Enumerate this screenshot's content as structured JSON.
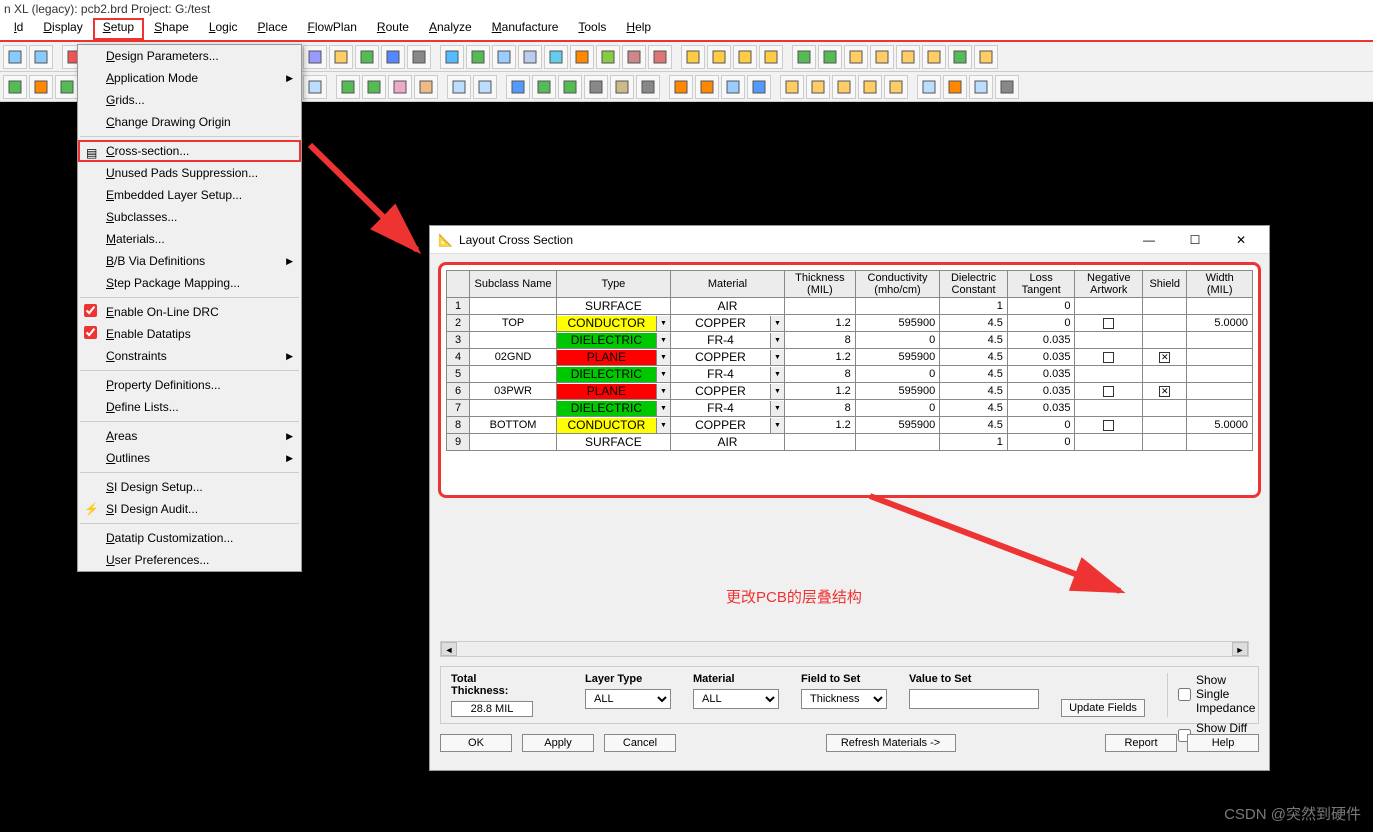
{
  "title": "n XL (legacy): pcb2.brd  Project: G:/test",
  "menubar": [
    "ld",
    "Display",
    "Setup",
    "Shape",
    "Logic",
    "Place",
    "FlowPlan",
    "Route",
    "Analyze",
    "Manufacture",
    "Tools",
    "Help"
  ],
  "menubar_open_index": 2,
  "setup_menu": {
    "items": [
      {
        "label": "Design Parameters...",
        "type": "item"
      },
      {
        "label": "Application Mode",
        "type": "sub"
      },
      {
        "label": "Grids...",
        "type": "item"
      },
      {
        "label": "Change Drawing Origin",
        "type": "item"
      },
      {
        "type": "sep"
      },
      {
        "label": "Cross-section...",
        "type": "item",
        "highlight": true,
        "icon": "stack"
      },
      {
        "label": "Unused Pads Suppression...",
        "type": "item"
      },
      {
        "label": "Embedded Layer Setup...",
        "type": "item"
      },
      {
        "label": "Subclasses...",
        "type": "item"
      },
      {
        "label": "Materials...",
        "type": "item"
      },
      {
        "label": "B/B Via Definitions",
        "type": "sub"
      },
      {
        "label": "Step Package Mapping...",
        "type": "item"
      },
      {
        "type": "sep"
      },
      {
        "label": "Enable On-Line DRC",
        "type": "check",
        "checked": true
      },
      {
        "label": "Enable Datatips",
        "type": "check",
        "checked": true
      },
      {
        "label": "Constraints",
        "type": "sub"
      },
      {
        "type": "sep"
      },
      {
        "label": "Property Definitions...",
        "type": "item"
      },
      {
        "label": "Define Lists...",
        "type": "item"
      },
      {
        "type": "sep"
      },
      {
        "label": "Areas",
        "type": "sub"
      },
      {
        "label": "Outlines",
        "type": "sub"
      },
      {
        "type": "sep"
      },
      {
        "label": "SI Design Setup...",
        "type": "item"
      },
      {
        "label": "SI Design Audit...",
        "type": "item",
        "icon": "bolt"
      },
      {
        "type": "sep"
      },
      {
        "label": "Datatip Customization...",
        "type": "item"
      },
      {
        "label": "User Preferences...",
        "type": "item"
      }
    ]
  },
  "dialog": {
    "title": "Layout Cross Section",
    "headers": [
      "",
      "Subclass Name",
      "Type",
      "Material",
      "Thickness (MIL)",
      "Conductivity (mho/cm)",
      "Dielectric Constant",
      "Loss Tangent",
      "Negative Artwork",
      "Shield",
      "Width (MIL)"
    ],
    "rows": [
      {
        "n": "1",
        "sub": "",
        "type": "SURFACE",
        "type_cls": "",
        "mat": "AIR",
        "thk": "",
        "cond": "",
        "dc": "1",
        "lt": "0",
        "neg": "",
        "sh": "",
        "w": ""
      },
      {
        "n": "2",
        "sub": "TOP",
        "type": "CONDUCTOR",
        "type_cls": "conductor",
        "mat": "COPPER",
        "thk": "1.2",
        "cond": "595900",
        "dc": "4.5",
        "lt": "0",
        "neg": "box",
        "sh": "",
        "w": "5.0000"
      },
      {
        "n": "3",
        "sub": "",
        "type": "DIELECTRIC",
        "type_cls": "dielectric",
        "mat": "FR-4",
        "thk": "8",
        "cond": "0",
        "dc": "4.5",
        "lt": "0.035",
        "neg": "",
        "sh": "",
        "w": ""
      },
      {
        "n": "4",
        "sub": "02GND",
        "type": "PLANE",
        "type_cls": "plane",
        "mat": "COPPER",
        "thk": "1.2",
        "cond": "595900",
        "dc": "4.5",
        "lt": "0.035",
        "neg": "box",
        "sh": "x",
        "w": ""
      },
      {
        "n": "5",
        "sub": "",
        "type": "DIELECTRIC",
        "type_cls": "dielectric",
        "mat": "FR-4",
        "thk": "8",
        "cond": "0",
        "dc": "4.5",
        "lt": "0.035",
        "neg": "",
        "sh": "",
        "w": ""
      },
      {
        "n": "6",
        "sub": "03PWR",
        "type": "PLANE",
        "type_cls": "plane",
        "mat": "COPPER",
        "thk": "1.2",
        "cond": "595900",
        "dc": "4.5",
        "lt": "0.035",
        "neg": "box",
        "sh": "x",
        "w": ""
      },
      {
        "n": "7",
        "sub": "",
        "type": "DIELECTRIC",
        "type_cls": "dielectric",
        "mat": "FR-4",
        "thk": "8",
        "cond": "0",
        "dc": "4.5",
        "lt": "0.035",
        "neg": "",
        "sh": "",
        "w": ""
      },
      {
        "n": "8",
        "sub": "BOTTOM",
        "type": "CONDUCTOR",
        "type_cls": "conductor",
        "mat": "COPPER",
        "thk": "1.2",
        "cond": "595900",
        "dc": "4.5",
        "lt": "0",
        "neg": "box",
        "sh": "",
        "w": "5.0000"
      },
      {
        "n": "9",
        "sub": "",
        "type": "SURFACE",
        "type_cls": "",
        "mat": "AIR",
        "thk": "",
        "cond": "",
        "dc": "1",
        "lt": "0",
        "neg": "",
        "sh": "",
        "w": ""
      }
    ],
    "total_thickness_label": "Total Thickness:",
    "total_thickness": "28.8 MIL",
    "layer_type_label": "Layer Type",
    "layer_type": "ALL",
    "material_label": "Material",
    "material": "ALL",
    "field_label": "Field to Set",
    "field": "Thickness",
    "value_label": "Value to Set",
    "value": "",
    "update_btn": "Update Fields",
    "show_single": "Show Single Impedance",
    "show_diff": "Show Diff Impedance",
    "buttons": {
      "ok": "OK",
      "apply": "Apply",
      "cancel": "Cancel",
      "refresh": "Refresh Materials ->",
      "report": "Report",
      "help": "Help"
    }
  },
  "annotation": "更改PCB的层叠结构",
  "watermark": "CSDN @突然到硬件"
}
